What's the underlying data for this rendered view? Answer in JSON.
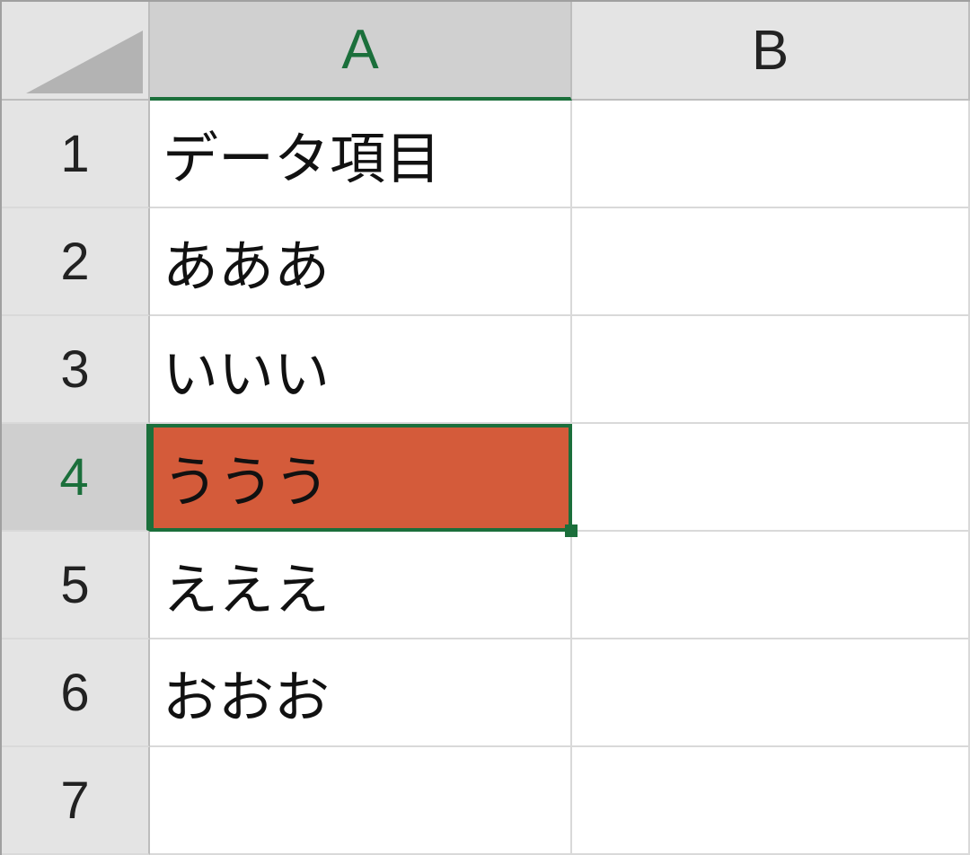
{
  "columns": {
    "A": "A",
    "B": "B"
  },
  "rows": {
    "1": "1",
    "2": "2",
    "3": "3",
    "4": "4",
    "5": "5",
    "6": "6",
    "7": "7"
  },
  "cells": {
    "A1": "データ項目",
    "A2": "あああ",
    "A3": "いいい",
    "A4": "ううう",
    "A5": "えええ",
    "A6": "おおお",
    "A7": "",
    "B1": "",
    "B2": "",
    "B3": "",
    "B4": "",
    "B5": "",
    "B6": "",
    "B7": ""
  },
  "active_cell": "A4",
  "active_fill_color": "#d45b3a",
  "selection_accent": "#1b6f3b"
}
